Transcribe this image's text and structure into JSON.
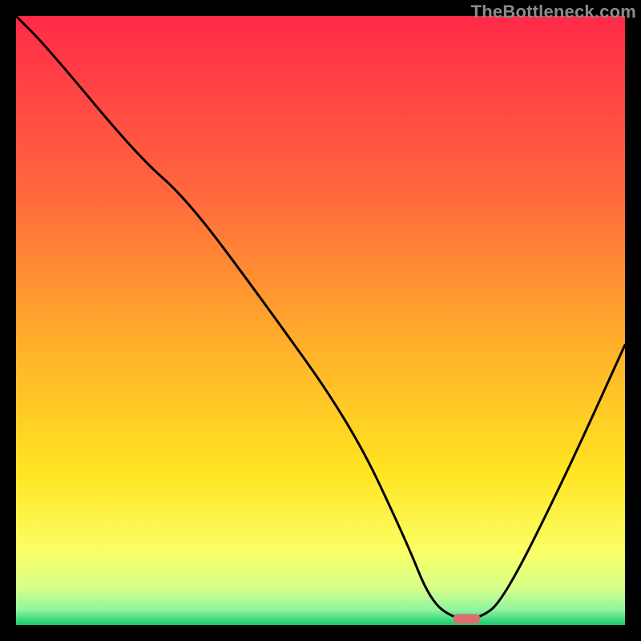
{
  "watermark": "TheBottleneck.com",
  "chart_data": {
    "type": "line",
    "title": "",
    "xlabel": "",
    "ylabel": "",
    "xlim": [
      0,
      100
    ],
    "ylim": [
      0,
      100
    ],
    "series": [
      {
        "name": "bottleneck-curve",
        "x": [
          0,
          5,
          20,
          28,
          40,
          55,
          64,
          68,
          72,
          76,
          80,
          90,
          100
        ],
        "values": [
          100,
          95,
          77,
          70,
          54,
          33,
          14,
          4,
          1,
          1,
          4,
          24,
          46
        ]
      }
    ],
    "marker": {
      "x": 74,
      "y": 1,
      "color": "#d9706d"
    },
    "gradient_stops": [
      {
        "offset": 0.0,
        "color": "#ff2a49"
      },
      {
        "offset": 0.3,
        "color": "#ff6a3c"
      },
      {
        "offset": 0.55,
        "color": "#ffb229"
      },
      {
        "offset": 0.75,
        "color": "#ffe522"
      },
      {
        "offset": 0.88,
        "color": "#fbff66"
      },
      {
        "offset": 0.94,
        "color": "#d6ff8a"
      },
      {
        "offset": 0.975,
        "color": "#8ff5a0"
      },
      {
        "offset": 1.0,
        "color": "#18c96b"
      }
    ]
  }
}
